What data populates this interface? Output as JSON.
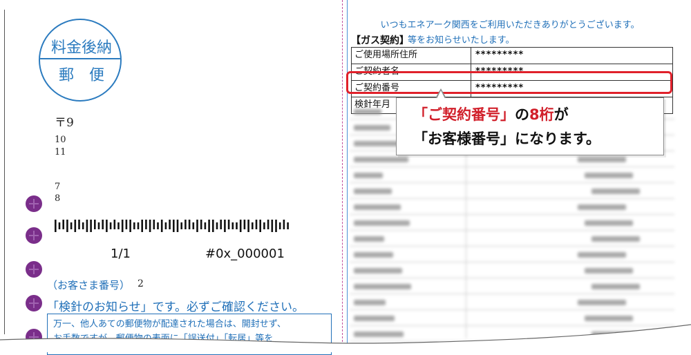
{
  "left": {
    "seal": {
      "line1": "料金後納",
      "line2": "郵　便"
    },
    "address": {
      "postal": "〒9",
      "line_a": "10",
      "line_b": "11",
      "line_c": "7",
      "line_d": "8"
    },
    "seq": "1/1",
    "code": "#0x_000001",
    "customer_number_label": "（お客さま番号）",
    "customer_number_value": "2",
    "meter_notice": "「検針のお知らせ」です。必ずご確認ください。",
    "note_lines": [
      "万一、他人あての郵便物が配達された場合は、開封せず、",
      "お手数ですが、郵便物の表面に「誤送付」「転居」等を"
    ]
  },
  "right": {
    "greeting_line1": "いつもエネアーク関西をご利用いただきありがとうございます。",
    "greeting_line2": "等をお知らせいたします。",
    "gas_contract_label": "【ガス契約】",
    "table": [
      {
        "label": "ご使用場所住所",
        "value": "*********"
      },
      {
        "label": "ご契約者名",
        "value": "*********"
      },
      {
        "label": "ご契約番号",
        "value": "*********"
      },
      {
        "label": "検針年月",
        "value": ""
      }
    ],
    "callout": {
      "line1_red": "「ご契約番号」",
      "line1_mid": "の",
      "line1_red2": "8桁",
      "line1_end": "が",
      "line2": "「お客様番号」になります。"
    }
  },
  "colors": {
    "brand_blue": "#1f6fb8",
    "highlight_red": "#e0202a",
    "punch_purple": "#7a2e8a"
  }
}
